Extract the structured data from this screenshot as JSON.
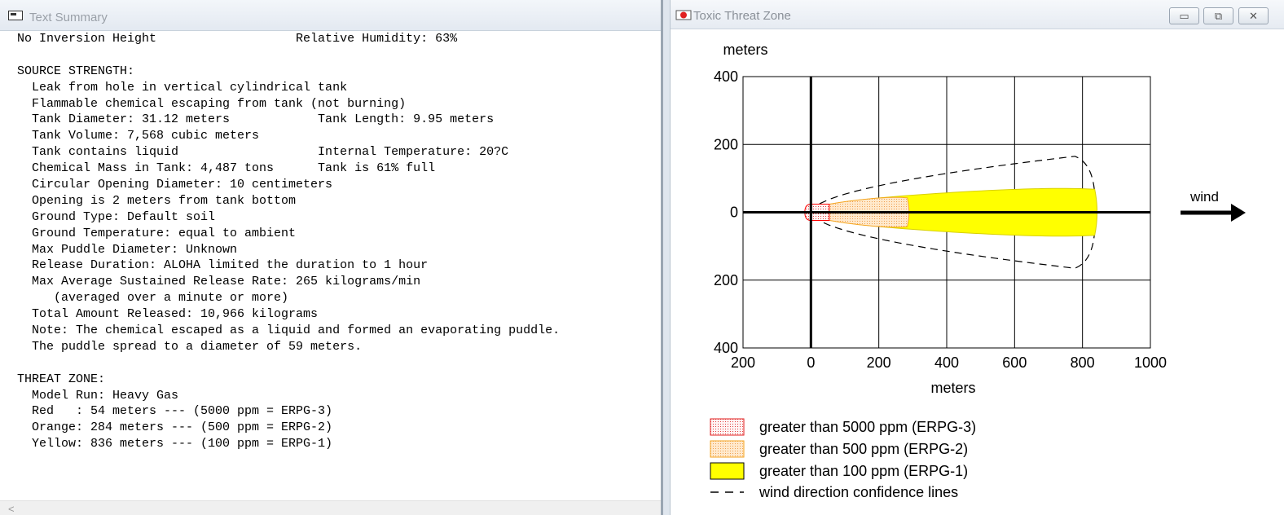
{
  "text_window": {
    "title": "Text Summary",
    "lines": [
      "No Inversion Height                   Relative Humidity: 63%",
      "",
      "SOURCE STRENGTH:",
      "  Leak from hole in vertical cylindrical tank",
      "  Flammable chemical escaping from tank (not burning)",
      "  Tank Diameter: 31.12 meters            Tank Length: 9.95 meters",
      "  Tank Volume: 7,568 cubic meters",
      "  Tank contains liquid                   Internal Temperature: 20?C",
      "  Chemical Mass in Tank: 4,487 tons      Tank is 61% full",
      "  Circular Opening Diameter: 10 centimeters",
      "  Opening is 2 meters from tank bottom",
      "  Ground Type: Default soil",
      "  Ground Temperature: equal to ambient",
      "  Max Puddle Diameter: Unknown",
      "  Release Duration: ALOHA limited the duration to 1 hour",
      "  Max Average Sustained Release Rate: 265 kilograms/min",
      "     (averaged over a minute or more)",
      "  Total Amount Released: 10,966 kilograms",
      "  Note: The chemical escaped as a liquid and formed an evaporating puddle.",
      "  The puddle spread to a diameter of 59 meters.",
      "",
      "THREAT ZONE:",
      "  Model Run: Heavy Gas",
      "  Red   : 54 meters --- (5000 ppm = ERPG-3)",
      "  Orange: 284 meters --- (500 ppm = ERPG-2)",
      "  Yellow: 836 meters --- (100 ppm = ERPG-1)"
    ],
    "scroll_arrow": "<"
  },
  "plot_window": {
    "title": "Toxic Threat Zone",
    "controls": {
      "minimize": "▭",
      "restore": "⧉",
      "close": "✕"
    },
    "wind_label": "wind",
    "legend": [
      {
        "label": "greater than 5000 ppm (ERPG-3)",
        "swatch": "red-dotted"
      },
      {
        "label": "greater than 500 ppm (ERPG-2)",
        "swatch": "orange-dotted"
      },
      {
        "label": "greater than 100 ppm (ERPG-1)",
        "swatch": "yellow"
      },
      {
        "label": "wind direction confidence lines",
        "swatch": "dashed"
      }
    ]
  },
  "chart_data": {
    "type": "area",
    "xlabel": "meters",
    "ylabel": "meters",
    "xlim": [
      -200,
      1000
    ],
    "ylim": [
      -400,
      400
    ],
    "x_ticks": [
      "200",
      "0",
      "200",
      "400",
      "600",
      "800",
      "1000"
    ],
    "y_ticks": [
      "400",
      "200",
      "0",
      "200",
      "400"
    ],
    "grid": true,
    "legend_position": "below",
    "zones": [
      {
        "name": "greater than 100 ppm (ERPG-1)",
        "color": "#ffff00",
        "downwind_extent_m": 836,
        "max_halfwidth_m": 80
      },
      {
        "name": "greater than 500 ppm (ERPG-2)",
        "color": "#ffd9a8",
        "downwind_extent_m": 284,
        "max_halfwidth_m": 50
      },
      {
        "name": "greater than 5000 ppm (ERPG-3)",
        "color": "#ffe8e8",
        "downwind_extent_m": 54,
        "max_halfwidth_m": 25
      }
    ],
    "confidence_lines": {
      "downwind_extent_m": 836,
      "max_halfwidth_m": 165
    },
    "colors": {
      "red": "#ff0000",
      "orange": "#f5a623",
      "yellow": "#ffff00"
    }
  }
}
